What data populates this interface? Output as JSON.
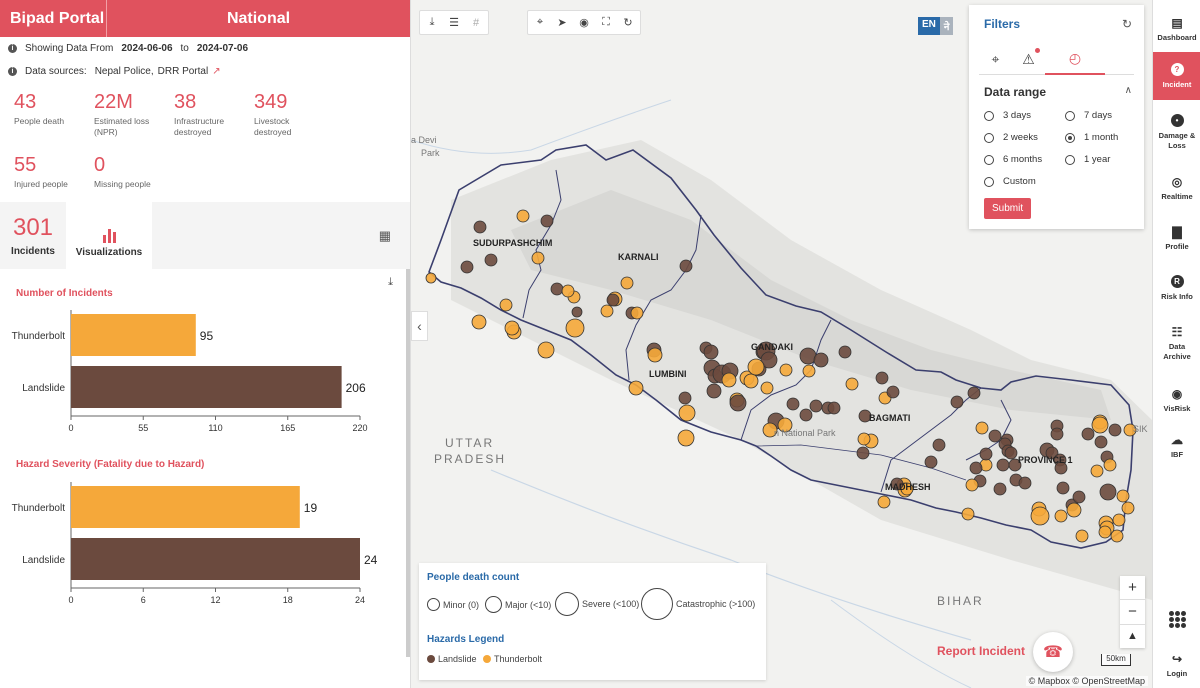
{
  "header": {
    "brand": "Bipad Portal",
    "region": "National"
  },
  "date_row": {
    "label": "Showing Data From",
    "from": "2024-06-06",
    "to_word": "to",
    "to": "2024-07-06"
  },
  "sources_row": {
    "label": "Data sources:",
    "sources": [
      "Nepal Police,",
      "DRR Portal"
    ]
  },
  "stats": [
    {
      "value": "43",
      "label": "People death"
    },
    {
      "value": "22M",
      "label": "Estimated loss (NPR)"
    },
    {
      "value": "38",
      "label": "Infrastructure destroyed"
    },
    {
      "value": "349",
      "label": "Livestock destroyed"
    },
    {
      "value": "55",
      "label": "Injured people"
    },
    {
      "value": "0",
      "label": "Missing people"
    }
  ],
  "tabs": {
    "incidents_count": "301",
    "incidents_label": "Incidents",
    "visualizations_label": "Visualizations"
  },
  "chart_data": [
    {
      "type": "bar",
      "title": "Number of Incidents",
      "categories": [
        "Thunderbolt",
        "Landslide"
      ],
      "values": [
        95,
        206
      ],
      "colors": [
        "#f5a83a",
        "#6b4a3e"
      ],
      "xlim": [
        0,
        220
      ],
      "xticks": [
        "0",
        "55",
        "110",
        "165",
        "220"
      ],
      "orientation": "horizontal"
    },
    {
      "type": "bar",
      "title": "Hazard Severity (Fatality due to Hazard)",
      "categories": [
        "Thunderbolt",
        "Landslide"
      ],
      "values": [
        19,
        24
      ],
      "colors": [
        "#f5a83a",
        "#6b4a3e"
      ],
      "xlim": [
        0,
        24
      ],
      "xticks": [
        "0",
        "6",
        "12",
        "18",
        "24"
      ],
      "orientation": "horizontal"
    }
  ],
  "map": {
    "lang_en": "EN",
    "lang_ne": "ने",
    "labels": {
      "sudurpashchim": "SUDURPASHCHIM",
      "karnali": "KARNALI",
      "gandaki": "GANDAKI",
      "lumbini": "LUMBINI",
      "bagmati": "BAGMATI",
      "madhesh": "MADHESH",
      "province1": "PROVINCE 1",
      "uttar": "UTTAR",
      "pradesh": "PRADESH",
      "bihar": "BIHAR",
      "devi": "a Devi",
      "park": "Park",
      "national_park": "n National Park",
      "sik": "SIK"
    },
    "filters": {
      "title": "Filters",
      "section": "Data range",
      "options": [
        "3 days",
        "7 days",
        "2 weeks",
        "1 month",
        "6 months",
        "1 year",
        "Custom"
      ],
      "selected": "1 month",
      "submit": "Submit"
    },
    "legend": {
      "death_title": "People death count",
      "death_items": [
        "Minor (0)",
        "Major (<10)",
        "Severe (<100)",
        "Catastrophic (>100)"
      ],
      "hazard_title": "Hazards Legend",
      "hazard_items": [
        "Landslide",
        "Thunderbolt"
      ]
    },
    "report_label": "Report Incident",
    "scale_label": "50km",
    "attribution": "© Mapbox © OpenStreetMap"
  },
  "nav": [
    {
      "label": "Dashboard",
      "icon": "dashboard-icon"
    },
    {
      "label": "Incident",
      "icon": "incident-icon"
    },
    {
      "label": "Damage & Loss",
      "icon": "damage-icon"
    },
    {
      "label": "Realtime",
      "icon": "realtime-icon"
    },
    {
      "label": "Profile",
      "icon": "profile-icon"
    },
    {
      "label": "Risk Info",
      "icon": "risk-info-icon"
    },
    {
      "label": "Data Archive",
      "icon": "archive-icon"
    },
    {
      "label": "VisRisk",
      "icon": "visrisk-icon"
    },
    {
      "label": "IBF",
      "icon": "ibf-icon"
    },
    {
      "label": "Login",
      "icon": "login-icon"
    }
  ],
  "colors": {
    "accent": "#e0525e",
    "landslide": "#6b4a3e",
    "thunderbolt": "#f5a83a",
    "link": "#2a6aa8"
  }
}
